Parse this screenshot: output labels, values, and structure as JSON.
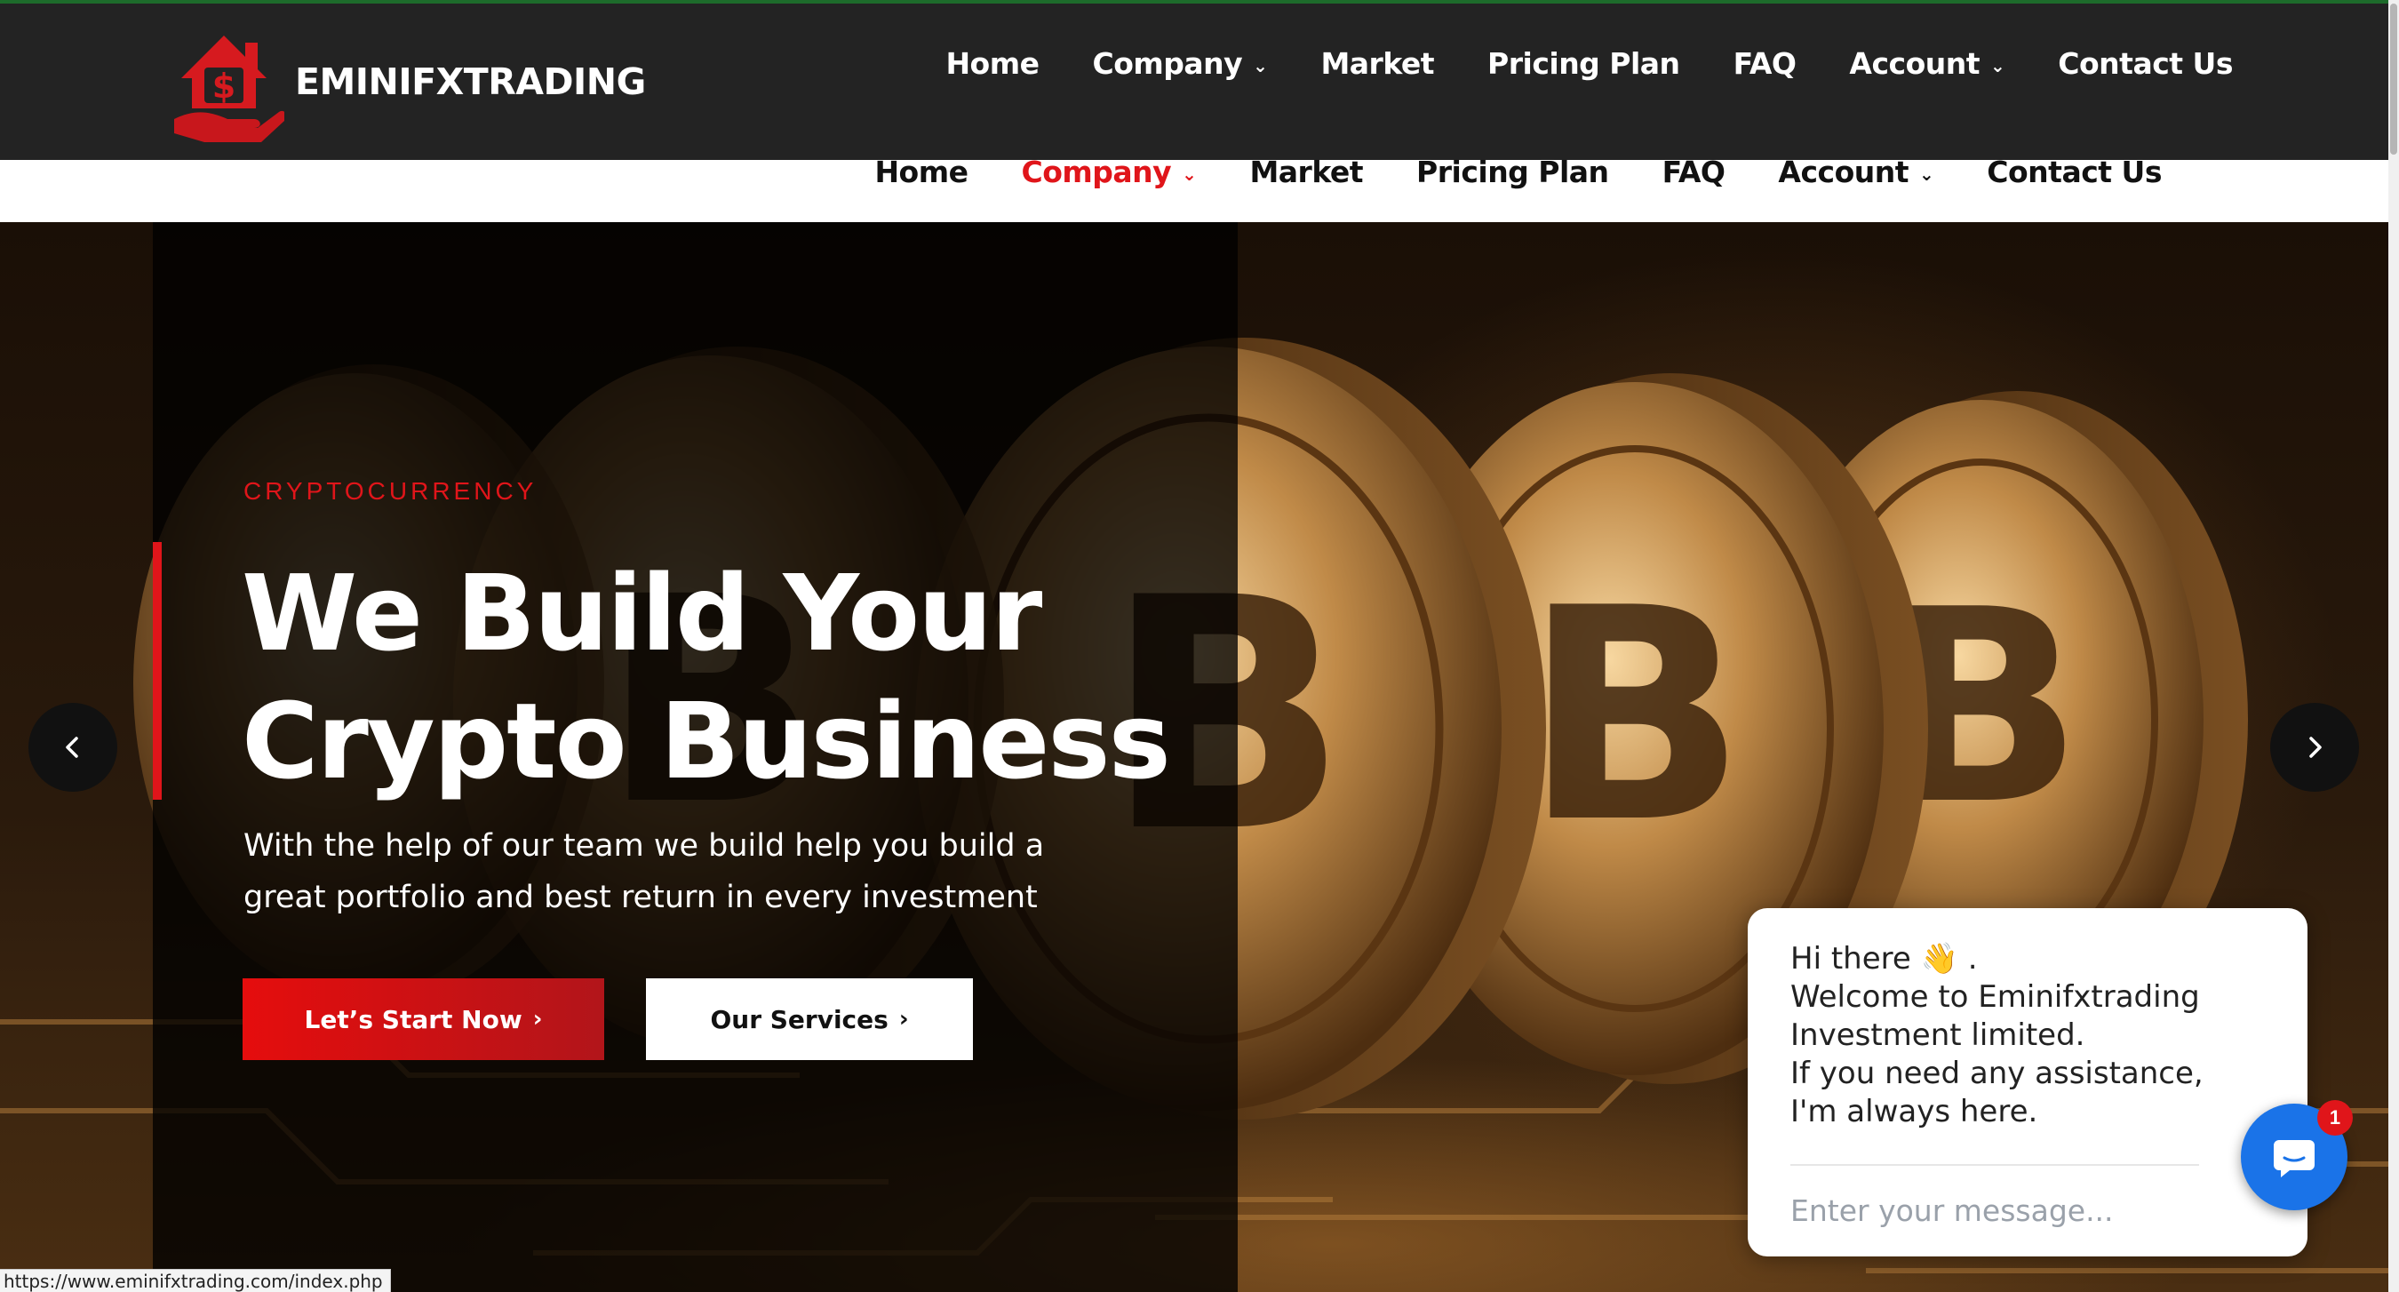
{
  "brand": {
    "name": "EMINIFXTRADING",
    "logo_icon": "house-dollar-hand-icon",
    "color": "#e0151a"
  },
  "nav": {
    "items": [
      {
        "label": "Home",
        "has_dropdown": false
      },
      {
        "label": "Company",
        "has_dropdown": true
      },
      {
        "label": "Market",
        "has_dropdown": false
      },
      {
        "label": "Pricing Plan",
        "has_dropdown": false
      },
      {
        "label": "FAQ",
        "has_dropdown": false
      },
      {
        "label": "Account",
        "has_dropdown": true
      },
      {
        "label": "Contact Us",
        "has_dropdown": false
      }
    ],
    "sticky_active": "Company"
  },
  "hero": {
    "eyebrow": "CRYPTOCURRENCY",
    "headline_line1": "We Build Your",
    "headline_line2": "Crypto Business",
    "subtext": "With the help of our team we build help you build a great portfolio and best return in every investment",
    "primary_button": "Let’s Start Now",
    "secondary_button": "Our Services",
    "arrow_prev": "chevron-left-icon",
    "arrow_next": "chevron-right-icon"
  },
  "chat": {
    "greeting_line1": "Hi there 👋 .",
    "greeting_line2": "Welcome to Eminifxtrading",
    "greeting_line3": "Investment limited.",
    "greeting_line4": "If you need any assistance,",
    "greeting_line5": "I'm always here.",
    "input_placeholder": "Enter your message...",
    "badge_count": "1"
  },
  "status_url": "https://www.eminifxtrading.com/index.php",
  "colors": {
    "header_bg": "#232323",
    "accent_red": "#e0151a",
    "chat_blue": "#1a73e8"
  }
}
